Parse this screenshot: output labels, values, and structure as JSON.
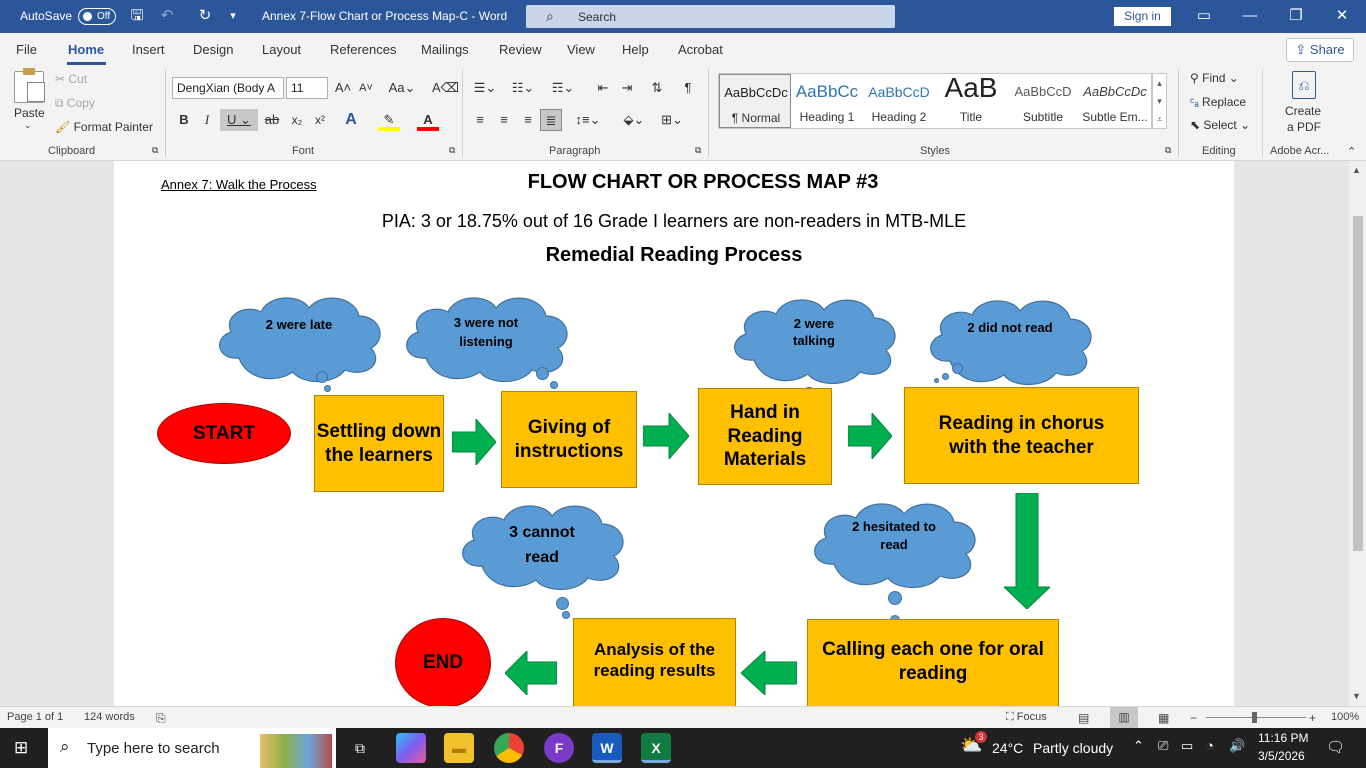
{
  "titlebar": {
    "autosave_label": "AutoSave",
    "autosave_state": "Off",
    "doc_title": "Annex 7-Flow Chart or Process Map-C  -  Word",
    "search_placeholder": "Search",
    "signin": "Sign in"
  },
  "menu": {
    "tabs": [
      "File",
      "Home",
      "Insert",
      "Design",
      "Layout",
      "References",
      "Mailings",
      "Review",
      "View",
      "Help",
      "Acrobat"
    ],
    "active": "Home",
    "share": "Share"
  },
  "ribbon": {
    "clipboard": {
      "paste": "Paste",
      "cut": "Cut",
      "copy": "Copy",
      "format_painter": "Format Painter",
      "label": "Clipboard"
    },
    "font": {
      "name": "DengXian (Body A",
      "size": "11",
      "label": "Font"
    },
    "paragraph": {
      "label": "Paragraph"
    },
    "styles": {
      "items": [
        {
          "preview": "AaBbCcDc",
          "name": "¶ Normal"
        },
        {
          "preview": "AaBbCc",
          "name": "Heading 1"
        },
        {
          "preview": "AaBbCcD",
          "name": "Heading 2"
        },
        {
          "preview": "AaB",
          "name": "Title"
        },
        {
          "preview": "AaBbCcD",
          "name": "Subtitle"
        },
        {
          "preview": "AaBbCcDc",
          "name": "Subtle Em..."
        }
      ],
      "label": "Styles"
    },
    "editing": {
      "find": "Find",
      "replace": "Replace",
      "select": "Select",
      "label": "Editing"
    },
    "adobe": {
      "create_pdf_1": "Create",
      "create_pdf_2": "a PDF",
      "label": "Adobe Acr..."
    }
  },
  "document": {
    "annex": "Annex 7: Walk the Process",
    "title": "FLOW CHART OR PROCESS MAP #3",
    "pia": "PIA: 3 or 18.75% out of 16 Grade I learners are non-readers in MTB-MLE",
    "subtitle": "Remedial Reading Process",
    "flow": {
      "start": "START",
      "end": "END",
      "steps": [
        "Settling down the learners",
        "Giving of instructions",
        "Hand in Reading Materials",
        "Reading in chorus with the teacher",
        "Calling each one for oral reading",
        "Analysis of the reading results"
      ],
      "clouds": [
        "2 were late",
        "3 were not listening",
        "2 were talking",
        "2 did not read",
        "3 cannot read",
        "2 hesitated to read"
      ]
    }
  },
  "statusbar": {
    "page": "Page 1 of 1",
    "words": "124 words",
    "focus": "Focus",
    "zoom": "100%"
  },
  "taskbar": {
    "search_placeholder": "Type here to search",
    "weather_temp": "24°C",
    "weather_desc": "Partly cloudy",
    "weather_badge": "3",
    "time": "11:16 PM",
    "date": "3/5/2026"
  }
}
